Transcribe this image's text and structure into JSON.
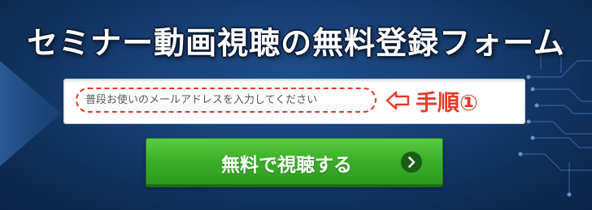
{
  "banner": {
    "title": "セミナー動画視聴の無料登録フォーム",
    "colors": {
      "background": "#173f74",
      "accent_red": "#e13c2a",
      "button_green": "#3db02a"
    }
  },
  "form": {
    "email_placeholder": "普段お使いのメールアドレスを入力してください",
    "email_value": "",
    "step_label": "手順①",
    "step_arrow_icon": "outline-left-arrow-icon",
    "submit_label": "無料で視聴する",
    "submit_icon": "chevron-right-circle-icon"
  }
}
